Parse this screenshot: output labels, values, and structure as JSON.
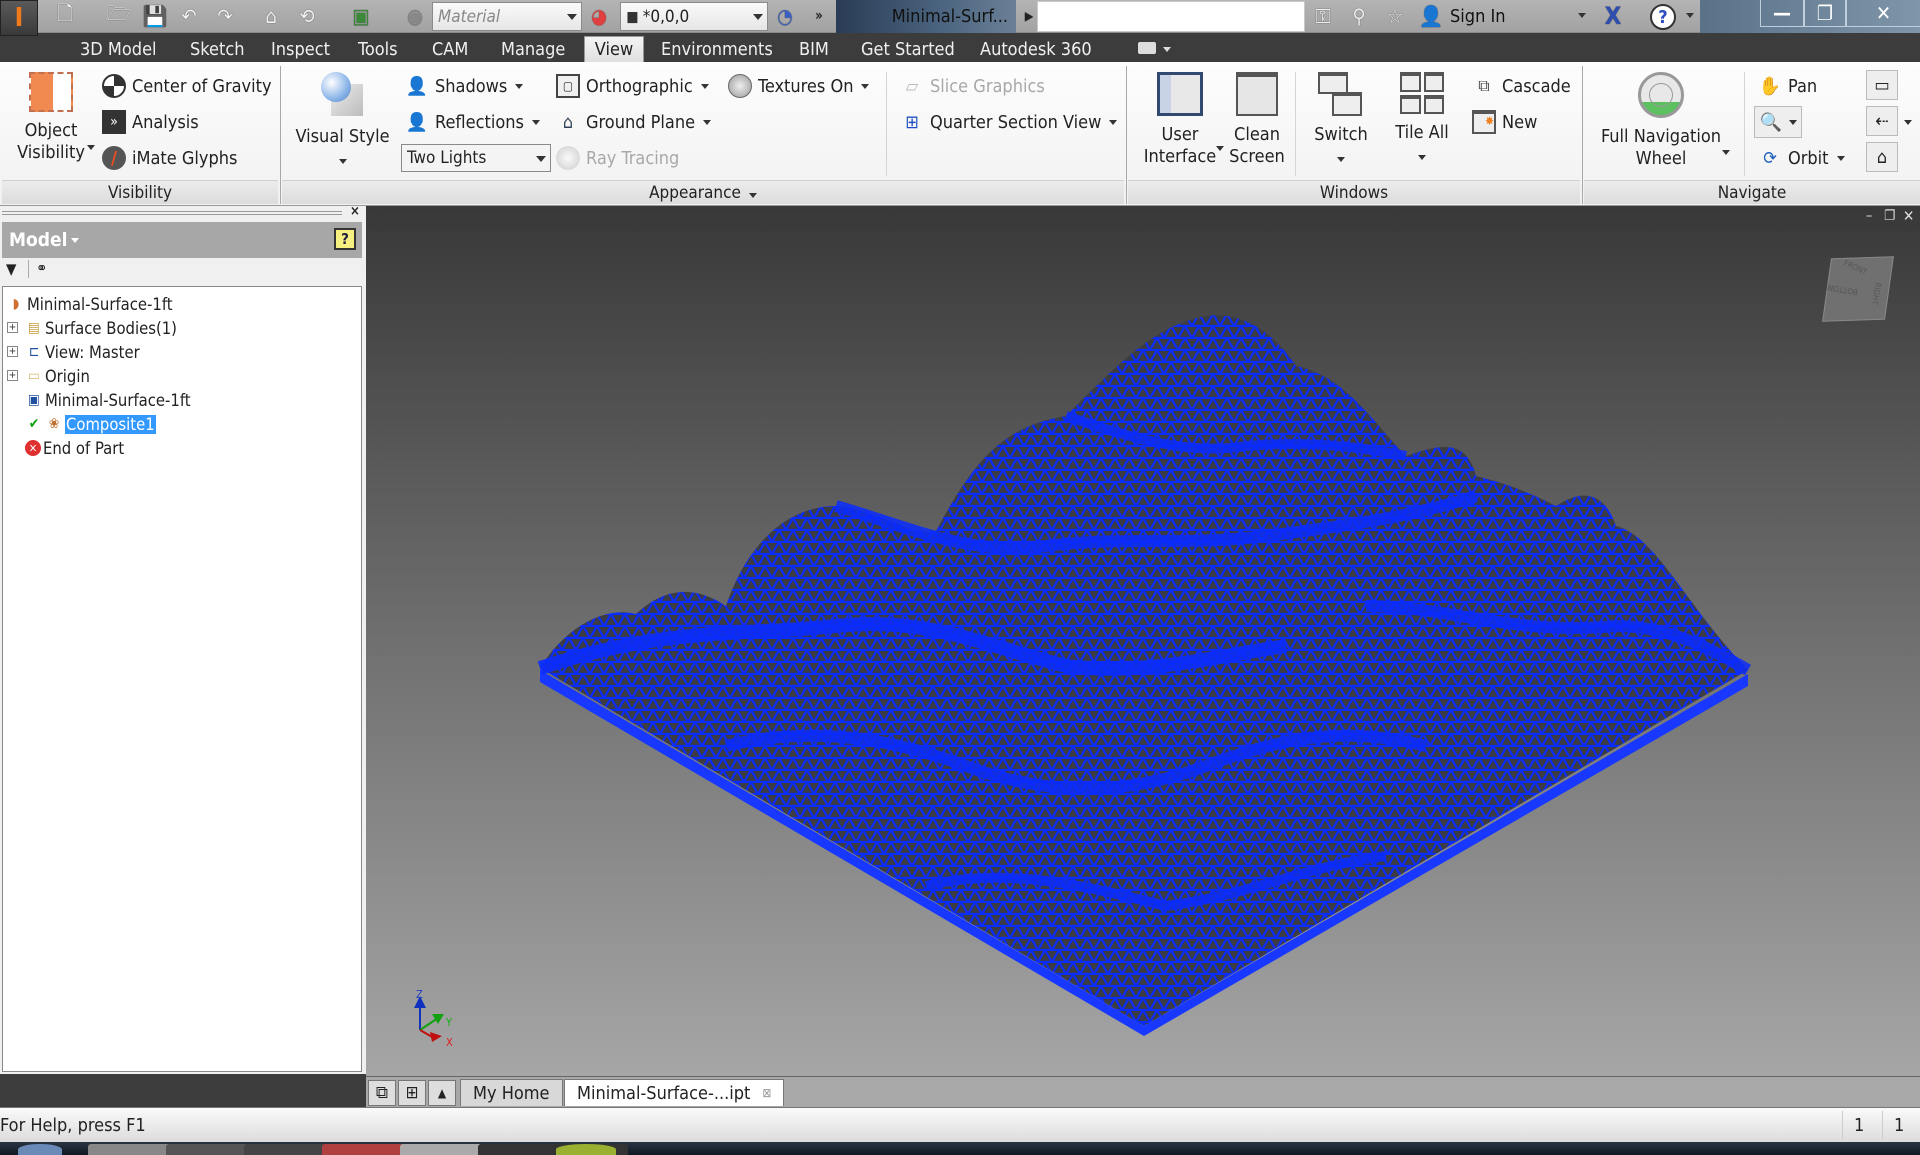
{
  "qat": {
    "material_placeholder": "Material",
    "appearance_value": "*0,0,0",
    "document_title": "Minimal-Surf...",
    "sign_in": "Sign In",
    "icons": [
      "app-menu-icon",
      "new-icon",
      "open-icon",
      "save-icon",
      "undo-icon",
      "redo-icon",
      "home-icon",
      "return-icon",
      "update-icon",
      "material-sphere-icon",
      "color-wheel-icon",
      "appearance-icon",
      "adjust-icon",
      "overflow-icon",
      "key-icon",
      "satellite-icon",
      "star-icon",
      "user-icon",
      "exchange-icon",
      "help-icon"
    ]
  },
  "window_controls": {
    "minimize": "—",
    "restore": "❐",
    "close": "✕"
  },
  "tabs": [
    "3D Model",
    "Sketch",
    "Inspect",
    "Tools",
    "CAM",
    "Manage",
    "View",
    "Environments",
    "BIM",
    "Get Started",
    "Autodesk 360"
  ],
  "active_tab": "View",
  "ribbon": {
    "visibility": {
      "label": "Visibility",
      "object_visibility_l1": "Object",
      "object_visibility_l2": "Visibility",
      "center_of_gravity": "Center of Gravity",
      "analysis": "Analysis",
      "imate_glyphs": "iMate Glyphs"
    },
    "appearance": {
      "label": "Appearance",
      "visual_style": "Visual Style",
      "shadows": "Shadows",
      "reflections": "Reflections",
      "lighting": "Two Lights",
      "orthographic": "Orthographic",
      "ground_plane": "Ground Plane",
      "ray_tracing": "Ray Tracing",
      "textures_on": "Textures On",
      "slice_graphics": "Slice Graphics",
      "quarter_section_view": "Quarter Section View"
    },
    "windows": {
      "label": "Windows",
      "user_interface_l1": "User",
      "user_interface_l2": "Interface",
      "clean_screen_l1": "Clean",
      "clean_screen_l2": "Screen",
      "switch": "Switch",
      "tile_all": "Tile All",
      "cascade": "Cascade",
      "new": "New"
    },
    "navigate": {
      "label": "Navigate",
      "full_nav_l1": "Full Navigation",
      "full_nav_l2": "Wheel",
      "pan": "Pan",
      "orbit": "Orbit"
    }
  },
  "browser": {
    "title": "Model",
    "help": "?",
    "tree": [
      {
        "label": "Minimal-Surface-1ft",
        "icon": "part-icon",
        "expandable": false,
        "level": 0
      },
      {
        "label": "Surface Bodies(1)",
        "icon": "surface-bodies-icon",
        "expandable": true,
        "level": 1
      },
      {
        "label": "View: Master",
        "icon": "view-rep-icon",
        "expandable": true,
        "level": 1
      },
      {
        "label": "Origin",
        "icon": "folder-icon",
        "expandable": true,
        "level": 1
      },
      {
        "label": "Minimal-Surface-1ft",
        "icon": "derived-part-icon",
        "expandable": false,
        "level": 1
      },
      {
        "label": "Composite1",
        "icon": "composite-icon",
        "expandable": false,
        "level": 1,
        "selected": true
      },
      {
        "label": "End of Part",
        "icon": "end-of-part-icon",
        "expandable": false,
        "level": 1
      }
    ]
  },
  "viewcube": {
    "front": "FRONT",
    "bottom": "BOTTOM",
    "right": "RIGHT"
  },
  "axes": {
    "z": "Z",
    "y": "Y",
    "x": "X"
  },
  "doc_tabs": {
    "home": "My Home",
    "active": "Minimal-Surface-...ipt"
  },
  "status": {
    "help": "For Help, press F1",
    "count1": "1",
    "count2": "1"
  },
  "colors": {
    "mesh": "#0a2cff",
    "mesh_dark": "#3c3c44",
    "accent_orange": "#f07a1a",
    "selection": "#3399ff"
  }
}
